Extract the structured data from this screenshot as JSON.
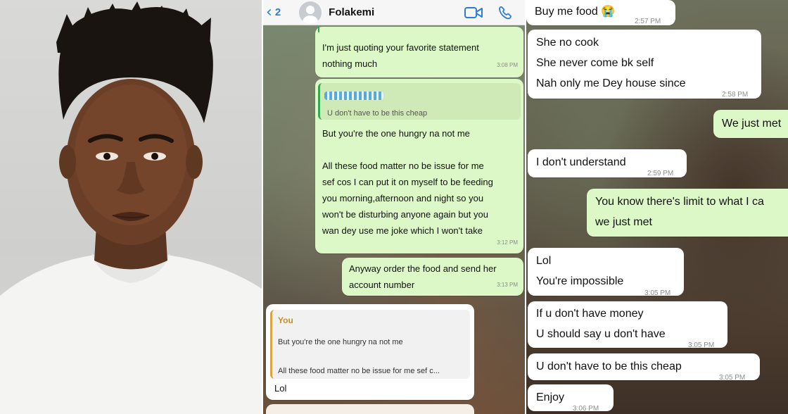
{
  "panel2": {
    "header": {
      "back_count": "2",
      "contact_name": "Folakemi"
    },
    "messages": [
      {
        "lines": [
          "I'm just quoting your favorite statement",
          "nothing much"
        ],
        "time": "3:08 PM"
      },
      {
        "quote": "U don't have to be this cheap",
        "lines": [
          "But you're the one hungry na not me",
          "",
          "All these food matter no be issue for me",
          "sef cos I can put it on myself to be feeding",
          "you morning,afternoon and night so you",
          "won't be disturbing anyone again but you",
          "wan dey use me joke which I won't take"
        ],
        "time": "3:12 PM"
      },
      {
        "lines": [
          "Anyway order the food and send her",
          "account number"
        ],
        "time": "3:13 PM"
      },
      {
        "quote_author": "You",
        "quote_lines": [
          "But you're the one hungry na not me",
          "",
          "All these food matter no be issue for me sef c..."
        ],
        "lines": [
          "Lol"
        ]
      }
    ]
  },
  "panel3": {
    "messages": [
      {
        "dir": "in",
        "lines": [
          "Buy me food 😭"
        ],
        "time": "2:57 PM"
      },
      {
        "dir": "in",
        "lines": [
          "She no cook",
          "She never come bk self",
          "Nah only me Dey house since"
        ],
        "time": "2:58 PM"
      },
      {
        "dir": "out",
        "lines": [
          "We just met"
        ]
      },
      {
        "dir": "in",
        "lines": [
          "I don't understand"
        ],
        "time": "2:59 PM"
      },
      {
        "dir": "out",
        "lines": [
          "You know there's limit to what I ca",
          "we just met"
        ]
      },
      {
        "dir": "in",
        "lines": [
          "Lol",
          "You're impossible"
        ],
        "time": "3:05 PM"
      },
      {
        "dir": "in",
        "lines": [
          "If u don't have money",
          "U should say u don't have"
        ],
        "time": "3:05 PM"
      },
      {
        "dir": "in",
        "lines": [
          "U don't have to be this cheap"
        ],
        "time": "3:05 PM"
      },
      {
        "dir": "in",
        "lines": [
          "Enjoy"
        ],
        "time": "3:06 PM"
      }
    ]
  },
  "colors": {
    "outgoing_bubble": "#dcf8c6",
    "incoming_bubble": "#ffffff",
    "header_blue": "#2f7bd9"
  },
  "icons": {
    "back": "chevron-left-icon",
    "video": "video-call-icon",
    "phone": "phone-icon",
    "avatar": "default-avatar-icon"
  }
}
